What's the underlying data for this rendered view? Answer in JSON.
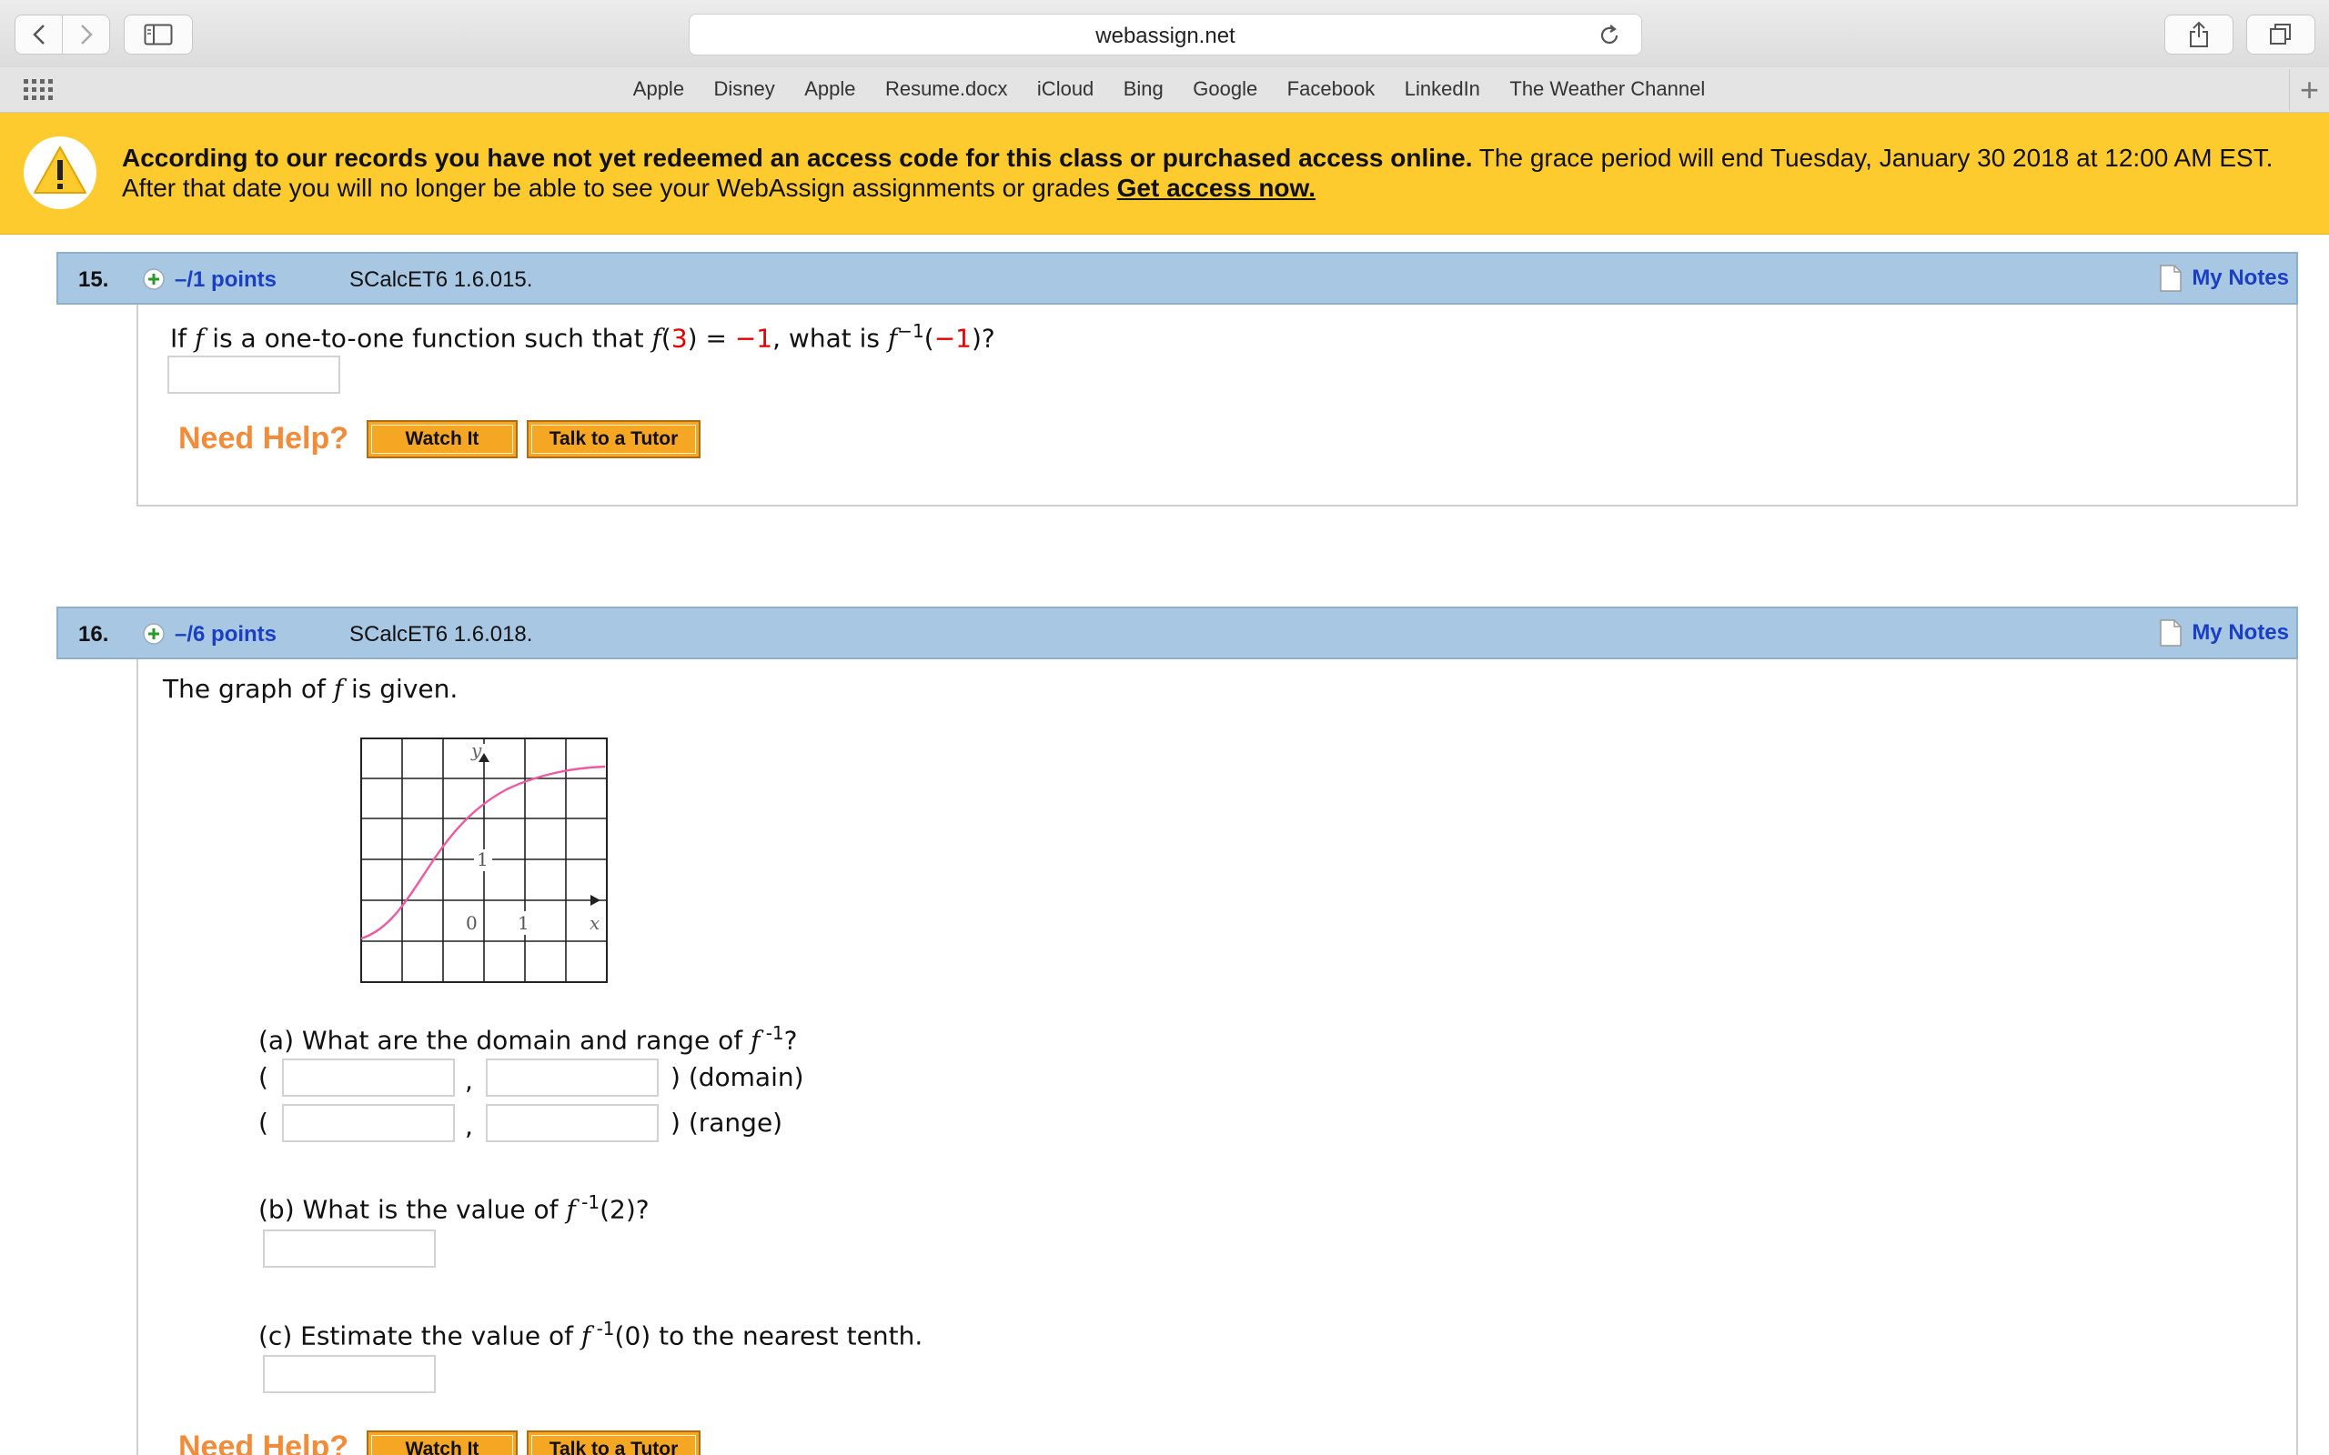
{
  "browser": {
    "url": "webassign.net",
    "favorites": [
      "Apple",
      "Disney",
      "Apple",
      "Resume.docx",
      "iCloud",
      "Bing",
      "Google",
      "Facebook",
      "LinkedIn",
      "The Weather Channel"
    ]
  },
  "banner": {
    "bold_text": "According to our records you have not yet redeemed an access code for this class or purchased access online.",
    "line1_rest": " The grace period will end Tuesday, January 30 2018 at 12:00 AM EST.",
    "line2": "After that date you will no longer be able to see your WebAssign assignments or grades ",
    "link": "Get access now."
  },
  "common": {
    "my_notes": "My Notes",
    "need_help": "Need Help?",
    "watch_it": "Watch It",
    "talk_to_tutor": "Talk to a Tutor"
  },
  "q15": {
    "number": "15.",
    "points": "–/1 points",
    "ref": "SCalcET6 1.6.015.",
    "text_pre": "If ",
    "f": "f",
    "text_mid1": " is a one-to-one function such that ",
    "f_of": "f",
    "arg": "3",
    "eq": " = ",
    "val": "−1",
    "text_mid2": ", what is ",
    "finv": "f",
    "sup": "−1",
    "paren_open": "(",
    "arg2": "−1",
    "paren_close": ")?"
  },
  "q16": {
    "number": "16.",
    "points": "–/6 points",
    "ref": "SCalcET6 1.6.018.",
    "intro_pre": "The graph of ",
    "intro_f": "f",
    "intro_post": " is given.",
    "graph": {
      "y_label": "y",
      "x_label": "x",
      "tick_y": "1",
      "tick_x": "1",
      "origin": "0"
    },
    "part_a": {
      "pre": "(a) What are the domain and range of ",
      "f": "f",
      "sup": " -1",
      "post": "?"
    },
    "domain_label": ") (domain)",
    "range_label": ") (range)",
    "open_paren": "(",
    "comma": ",",
    "part_b": {
      "pre": "(b) What is the value of ",
      "f": "f",
      "sup": " -1",
      "post": "(2)?"
    },
    "part_c": {
      "pre": "(c) Estimate the value of ",
      "f": "f",
      "sup": " -1",
      "post": "(0) to the nearest tenth."
    }
  }
}
